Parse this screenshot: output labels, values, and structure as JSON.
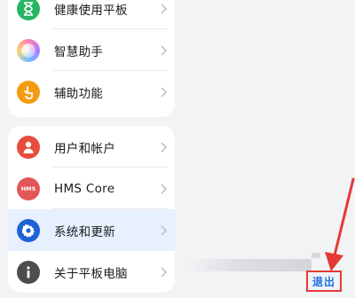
{
  "menu_top": [
    {
      "label": "健康使用平板",
      "icon": "hourglass-icon",
      "color": "#28b463"
    },
    {
      "label": "智慧助手",
      "icon": "assistant-orb-icon",
      "color": "#b07cff"
    },
    {
      "label": "辅助功能",
      "icon": "hand-pointer-icon",
      "color": "#f39c12"
    }
  ],
  "menu_bottom": [
    {
      "label": "用户和帐户",
      "icon": "user-icon",
      "color": "#e74c3c"
    },
    {
      "label": "HMS Core",
      "icon": "hms-logo-icon",
      "color": "#e35656",
      "icon_text": "HMS"
    },
    {
      "label": "系统和更新",
      "icon": "gear-icon",
      "color": "#1e63d6",
      "selected": true
    },
    {
      "label": "关于平板电脑",
      "icon": "info-icon",
      "color": "#4d4d4d"
    }
  ],
  "action": {
    "logout_label": "退出"
  },
  "colors": {
    "accent": "#1f6fe0",
    "highlight_border": "#e53935",
    "selected_bg": "#e6f0ff"
  }
}
